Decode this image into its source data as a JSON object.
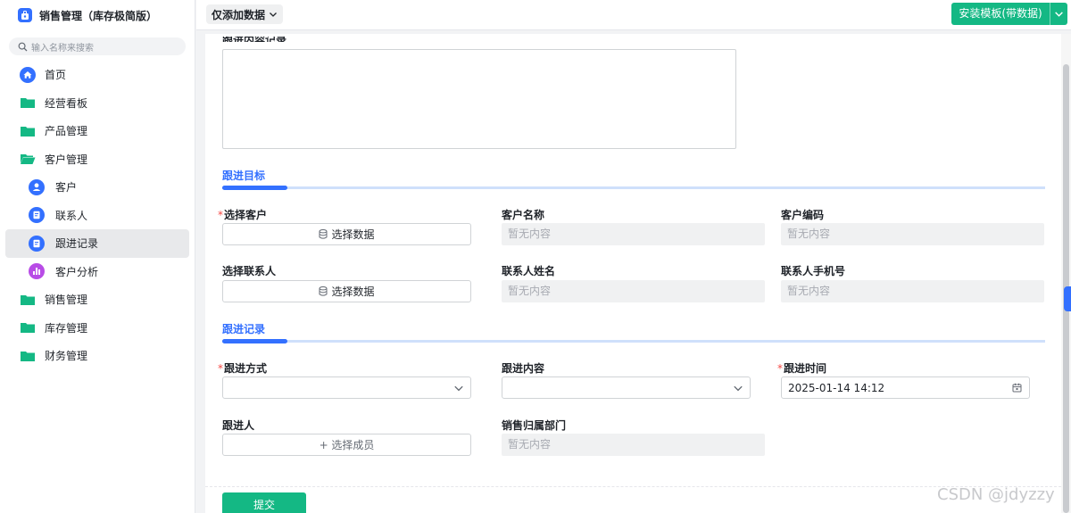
{
  "app": {
    "title": "销售管理（库存极简版）"
  },
  "search": {
    "placeholder": "输入名称来搜索"
  },
  "sidebar": {
    "items": [
      {
        "label": "首页",
        "icon": "home-icon"
      },
      {
        "label": "经营看板",
        "icon": "folder-icon"
      },
      {
        "label": "产品管理",
        "icon": "folder-icon"
      },
      {
        "label": "客户管理",
        "icon": "folder-open-icon"
      },
      {
        "label": "客户",
        "icon": "user-icon"
      },
      {
        "label": "联系人",
        "icon": "form-icon"
      },
      {
        "label": "跟进记录",
        "icon": "form-icon",
        "active": true
      },
      {
        "label": "客户分析",
        "icon": "chart-icon"
      },
      {
        "label": "销售管理",
        "icon": "folder-icon"
      },
      {
        "label": "库存管理",
        "icon": "folder-icon"
      },
      {
        "label": "财务管理",
        "icon": "folder-icon"
      }
    ]
  },
  "topbar": {
    "view_label": "仅添加数据",
    "install_label": "安装模板(带数据)"
  },
  "form": {
    "cut_label": "跟进内容记录",
    "section_target": "跟进目标",
    "select_customer_label": "选择客户",
    "select_data_label": "选择数据",
    "customer_name_label": "客户名称",
    "customer_code_label": "客户编码",
    "select_contact_label": "选择联系人",
    "contact_name_label": "联系人姓名",
    "contact_phone_label": "联系人手机号",
    "empty_text": "暂无内容",
    "section_record": "跟进记录",
    "method_label": "跟进方式",
    "content_label": "跟进内容",
    "time_label": "跟进时间",
    "time_value": "2025-01-14 14:12",
    "person_label": "跟进人",
    "select_member_label": "+ 选择成员",
    "department_label": "销售归属部门",
    "submit_label": "提交"
  },
  "watermark": "CSDN @jdyzzy",
  "colors": {
    "accent": "#3370ff",
    "primary_button": "#14b884",
    "required": "#f54a45"
  }
}
